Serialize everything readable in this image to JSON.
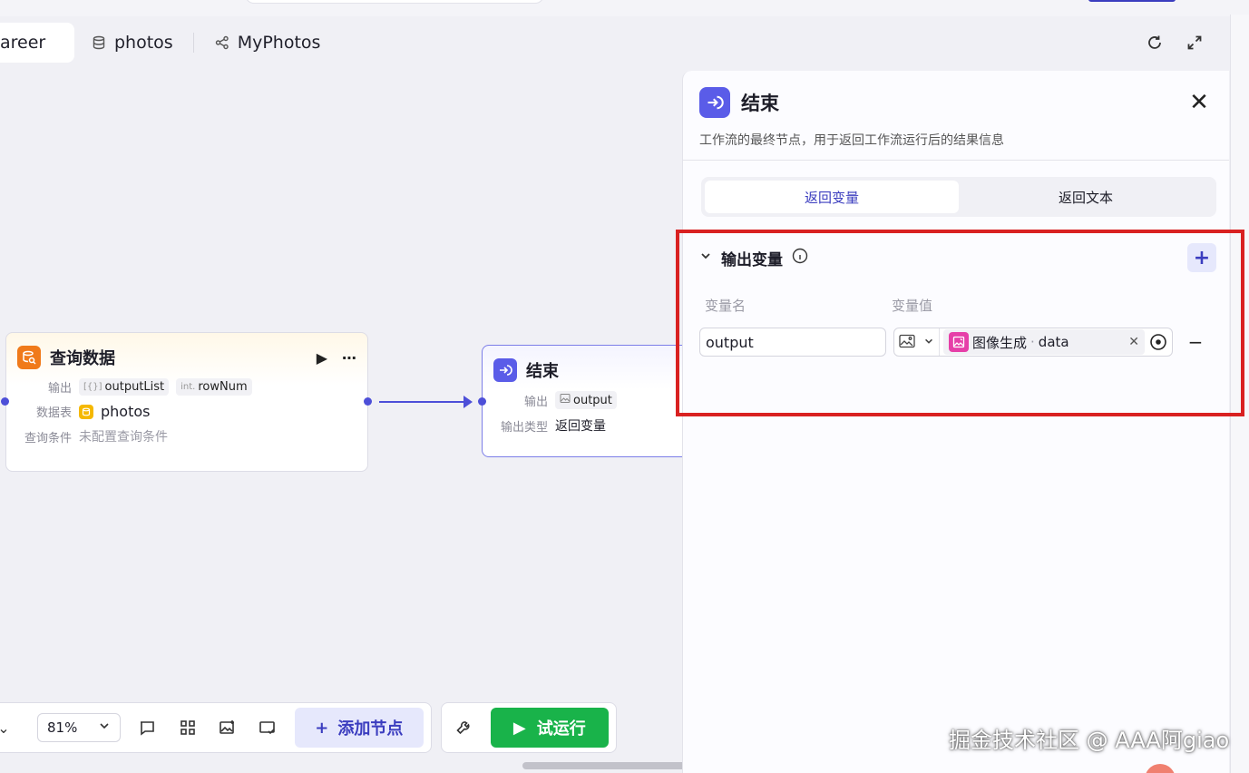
{
  "tabs": [
    {
      "label": "areer",
      "icon": "none"
    },
    {
      "label": "photos",
      "icon": "database-icon"
    },
    {
      "label": "MyPhotos",
      "icon": "workflow-icon"
    }
  ],
  "query_node": {
    "title": "查询数据",
    "output_label": "输出",
    "output_tags": [
      {
        "prefix": "[{}]",
        "name": "outputList"
      },
      {
        "prefix": "int.",
        "name": "rowNum"
      }
    ],
    "table_label": "数据表",
    "table_value": "photos",
    "condition_label": "查询条件",
    "condition_value": "未配置查询条件"
  },
  "end_node": {
    "title": "结束",
    "output_label": "输出",
    "output_value": "output",
    "type_label": "输出类型",
    "type_value": "返回变量"
  },
  "toolbar": {
    "zoom": "81%",
    "add_node": "添加节点",
    "run": "试运行"
  },
  "panel": {
    "title": "结束",
    "description": "工作流的最终节点，用于返回工作流运行后的结果信息",
    "segments": [
      "返回变量",
      "返回文本"
    ],
    "section_title": "输出变量",
    "col_name": "变量名",
    "col_value": "变量值",
    "variable": {
      "name": "output",
      "ref_source": "图像生成",
      "ref_sep": "·",
      "ref_field": "data"
    }
  },
  "watermark": "掘金技术社区 @ AAA阿giao",
  "colors": {
    "accent": "#3b3dbf",
    "run_green": "#19b34a",
    "highlight_red": "#d92121",
    "query_orange": "#f07a1a",
    "image_pink": "#e63fa8"
  }
}
